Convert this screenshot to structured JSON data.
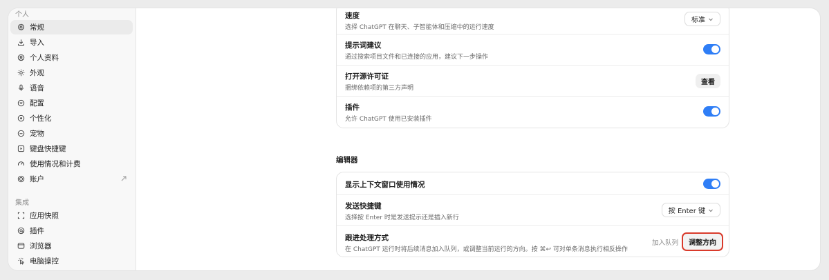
{
  "sidebar": {
    "group_personal": "个人",
    "group_integrations": "集成",
    "items": [
      {
        "label": "常规",
        "icon": "gear-icon"
      },
      {
        "label": "导入",
        "icon": "download-icon"
      },
      {
        "label": "个人资料",
        "icon": "profile-icon"
      },
      {
        "label": "外观",
        "icon": "sun-icon"
      },
      {
        "label": "语音",
        "icon": "microphone-icon"
      },
      {
        "label": "配置",
        "icon": "config-icon"
      },
      {
        "label": "个性化",
        "icon": "personalize-icon"
      },
      {
        "label": "宠物",
        "icon": "pet-icon"
      },
      {
        "label": "键盘快捷键",
        "icon": "keyboard-icon"
      },
      {
        "label": "使用情况和计费",
        "icon": "gauge-icon"
      },
      {
        "label": "账户",
        "icon": "account-icon"
      }
    ],
    "integrations": [
      {
        "label": "应用快照",
        "icon": "snapshot-icon"
      },
      {
        "label": "插件",
        "icon": "plugin-icon"
      },
      {
        "label": "浏览器",
        "icon": "browser-icon"
      },
      {
        "label": "电脑操控",
        "icon": "computer-control-icon"
      }
    ]
  },
  "general_card": {
    "speed": {
      "title": "速度",
      "desc": "选择 ChatGPT 在聊天、子智能体和压缩中的运行速度",
      "value": "标准"
    },
    "prompt_suggest": {
      "title": "提示词建议",
      "desc": "通过搜索项目文件和已连接的应用，建议下一步操作",
      "enabled": true
    },
    "open_source": {
      "title": "打开源许可证",
      "desc": "捆绑依赖项的第三方声明",
      "button": "查看"
    },
    "plugins": {
      "title": "插件",
      "desc": "允许 ChatGPT 使用已安装插件",
      "enabled": true
    }
  },
  "editor": {
    "section_title": "编辑器",
    "context_usage": {
      "title": "显示上下文窗口使用情况",
      "enabled": true
    },
    "send_shortcut": {
      "title": "发送快捷键",
      "desc": "选择按 Enter 时是发送提示还是插入新行",
      "value": "按 Enter 键"
    },
    "followup": {
      "title": "跟进处理方式",
      "desc": "在 ChatGPT 运行时将后续消息加入队列，或调整当前运行的方向。按 ⌘↩ 可对单条消息执行相反操作",
      "option_queue": "加入队列",
      "option_steer": "调整方向"
    }
  },
  "colors": {
    "accent_toggle": "#2f7ef6",
    "highlight_outline": "#d93a2b"
  }
}
